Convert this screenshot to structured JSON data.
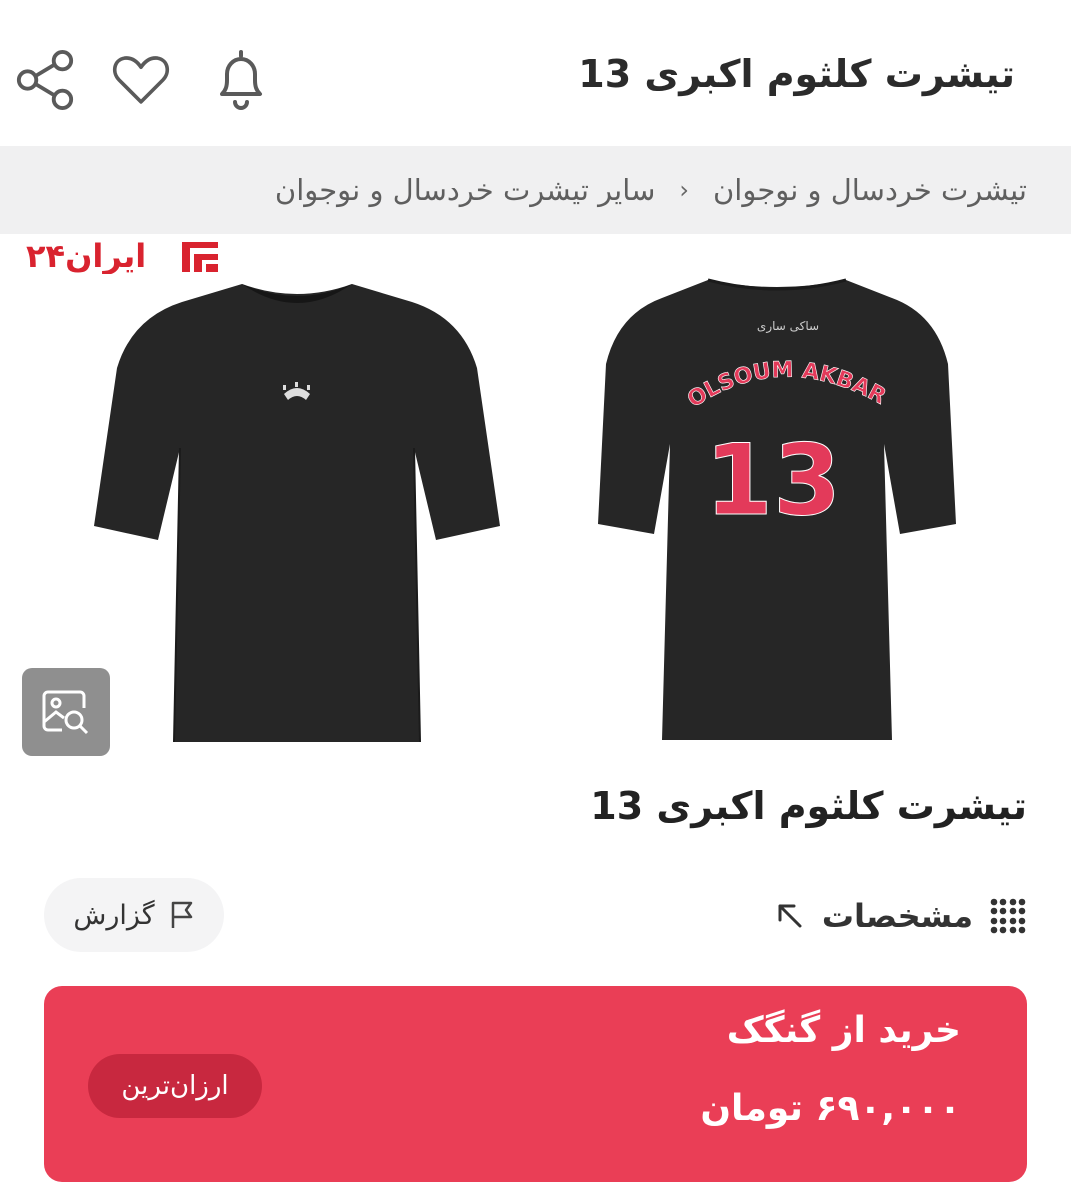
{
  "header": {
    "title": "تیشرت کلثوم اکبری 13",
    "icons": [
      "bell-icon",
      "heart-icon",
      "share-icon"
    ]
  },
  "breadcrumb": {
    "items": [
      "تیشرت خردسال و نوجوان",
      "سایر تیشرت خردسال و نوجوان"
    ],
    "separator": "‹"
  },
  "gallery": {
    "watermark": "ایران۲۴",
    "front_image": "black t-shirt front",
    "back_image": "black t-shirt back",
    "back_print": {
      "small_text": "ساکی ساری",
      "name": "KOLSOUM AKBARI",
      "number": "13"
    },
    "visual_search_icon": "image-search-icon"
  },
  "product": {
    "title": "تیشرت کلثوم اکبری 13"
  },
  "actions": {
    "report_label": "گزارش",
    "specs_label": "مشخصات"
  },
  "offer": {
    "title": "خرید از گنگک",
    "price": "۶۹۰,۰۰۰ تومان",
    "badge": "ارزان‌ترین"
  },
  "colors": {
    "accent": "#ea3e56",
    "badge": "#c8283f",
    "breadcrumb_bg": "#f0f0f1",
    "print_red": "#e33a5a",
    "shirt": "#242424"
  }
}
